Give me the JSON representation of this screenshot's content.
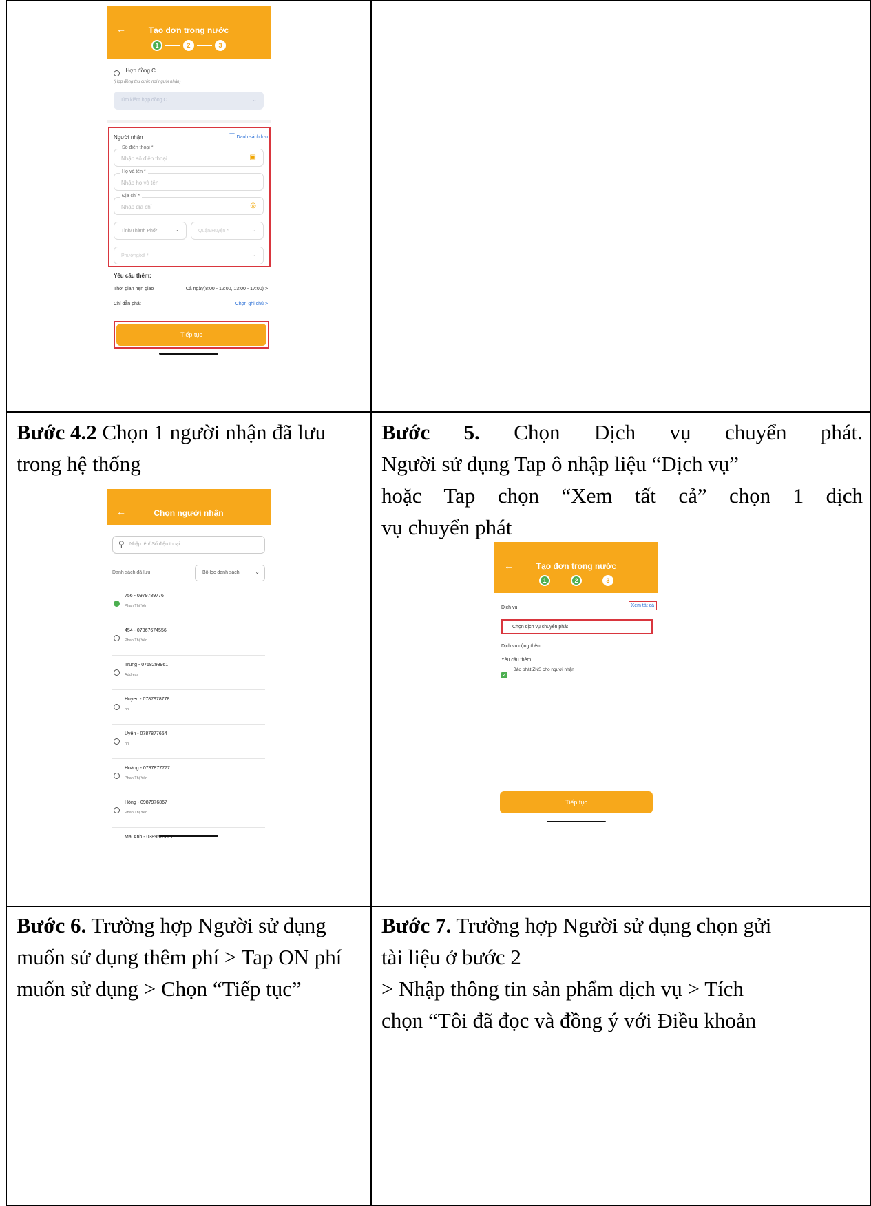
{
  "screen1": {
    "title": "Tạo đơn trong nước",
    "steps": [
      "1",
      "2",
      "3"
    ],
    "contract_label": "Hợp đồng C",
    "contract_note": "(Hợp đồng thu cước nơi người nhận)",
    "contract_search_placeholder": "Tìm kiếm hợp đồng C",
    "recipient_heading": "Người nhận",
    "saved_list_link": "Danh sách lưu",
    "phone_label": "Số điện thoại *",
    "phone_placeholder": "Nhập số điện thoại",
    "name_label": "Họ và tên *",
    "name_placeholder": "Nhập họ và tên",
    "address_label": "Địa chỉ *",
    "address_placeholder": "Nhập địa chỉ",
    "province_placeholder": "Tỉnh/Thành Phố*",
    "district_placeholder": "Quận/Huyện *",
    "ward_placeholder": "Phường/xã *",
    "extra_heading": "Yêu cầu thêm:",
    "delivery_time_label": "Thời gian hẹn giao",
    "delivery_time_value": "Cả ngày(8:00 - 12:00, 13:00 - 17:00) >",
    "delivery_note_label": "Chỉ dẫn phát",
    "delivery_note_value": "Chọn ghi chú >",
    "continue_button": "Tiếp tục"
  },
  "step42": {
    "bold": "Bước 4.2",
    "text": " Chọn 1 người nhận đã lưu",
    "line2": "trong hệ thống"
  },
  "screen2": {
    "title": "Chọn người nhận",
    "search_placeholder": "Nhập tên/ Số điện thoại",
    "saved_label": "Danh sách đã lưu",
    "filter_label": "Bộ lọc danh sách",
    "contacts": [
      {
        "name": "756 - 0979789776",
        "sub": "Phan Thị Yến",
        "checked": true
      },
      {
        "name": "454 - 07867674556",
        "sub": "Phan Thị Yến",
        "checked": false
      },
      {
        "name": "Trung - 0768298961",
        "sub": "Address",
        "checked": false
      },
      {
        "name": "Huyen - 0787978778",
        "sub": "hh",
        "checked": false
      },
      {
        "name": "Uyên - 0787877654",
        "sub": "hh",
        "checked": false
      },
      {
        "name": "Hoàng - 0787877777",
        "sub": "Phan Thị Yến",
        "checked": false
      },
      {
        "name": "Hồng - 0987976867",
        "sub": "Phan Thị Yến",
        "checked": false
      },
      {
        "name": "Mai Anh - 0389573821",
        "sub": "",
        "checked": false
      }
    ]
  },
  "step5": {
    "bold": "Bước 5.",
    "line1": " Chọn Dịch vụ chuyển phát.",
    "line2": "Người sử dụng Tap ô nhập liệu “Dịch vụ”",
    "line3": "hoặc Tap chọn “Xem tất cả” chọn 1 dịch",
    "line4": "vụ chuyển phát"
  },
  "screen3": {
    "title": "Tạo đơn trong nước",
    "steps": [
      "1",
      "2",
      "3"
    ],
    "service_label": "Dịch vụ",
    "see_all": "Xem tất cả",
    "service_placeholder": "Chọn dịch vụ chuyển phát",
    "addon_label": "Dịch vụ cộng thêm",
    "extra_label": "Yêu cầu thêm",
    "zns_label": "Báo phát ZNS cho người nhận",
    "continue_button": "Tiếp tục"
  },
  "step6": {
    "bold": "Bước 6.",
    "line1": " Trường hợp Người sử dụng",
    "line2": "muốn sử dụng thêm phí > Tap ON phí",
    "line3": "muốn sử dụng > Chọn “Tiếp tục”"
  },
  "step7": {
    "bold": "Bước 7.",
    "line1": " Trường hợp Người sử dụng chọn gửi",
    "line2": "tài liệu ở bước 2",
    "line3": "> Nhập thông tin sản phẩm dịch vụ > Tích",
    "line4": "chọn “Tôi đã đọc và đồng ý với Điều khoản"
  }
}
